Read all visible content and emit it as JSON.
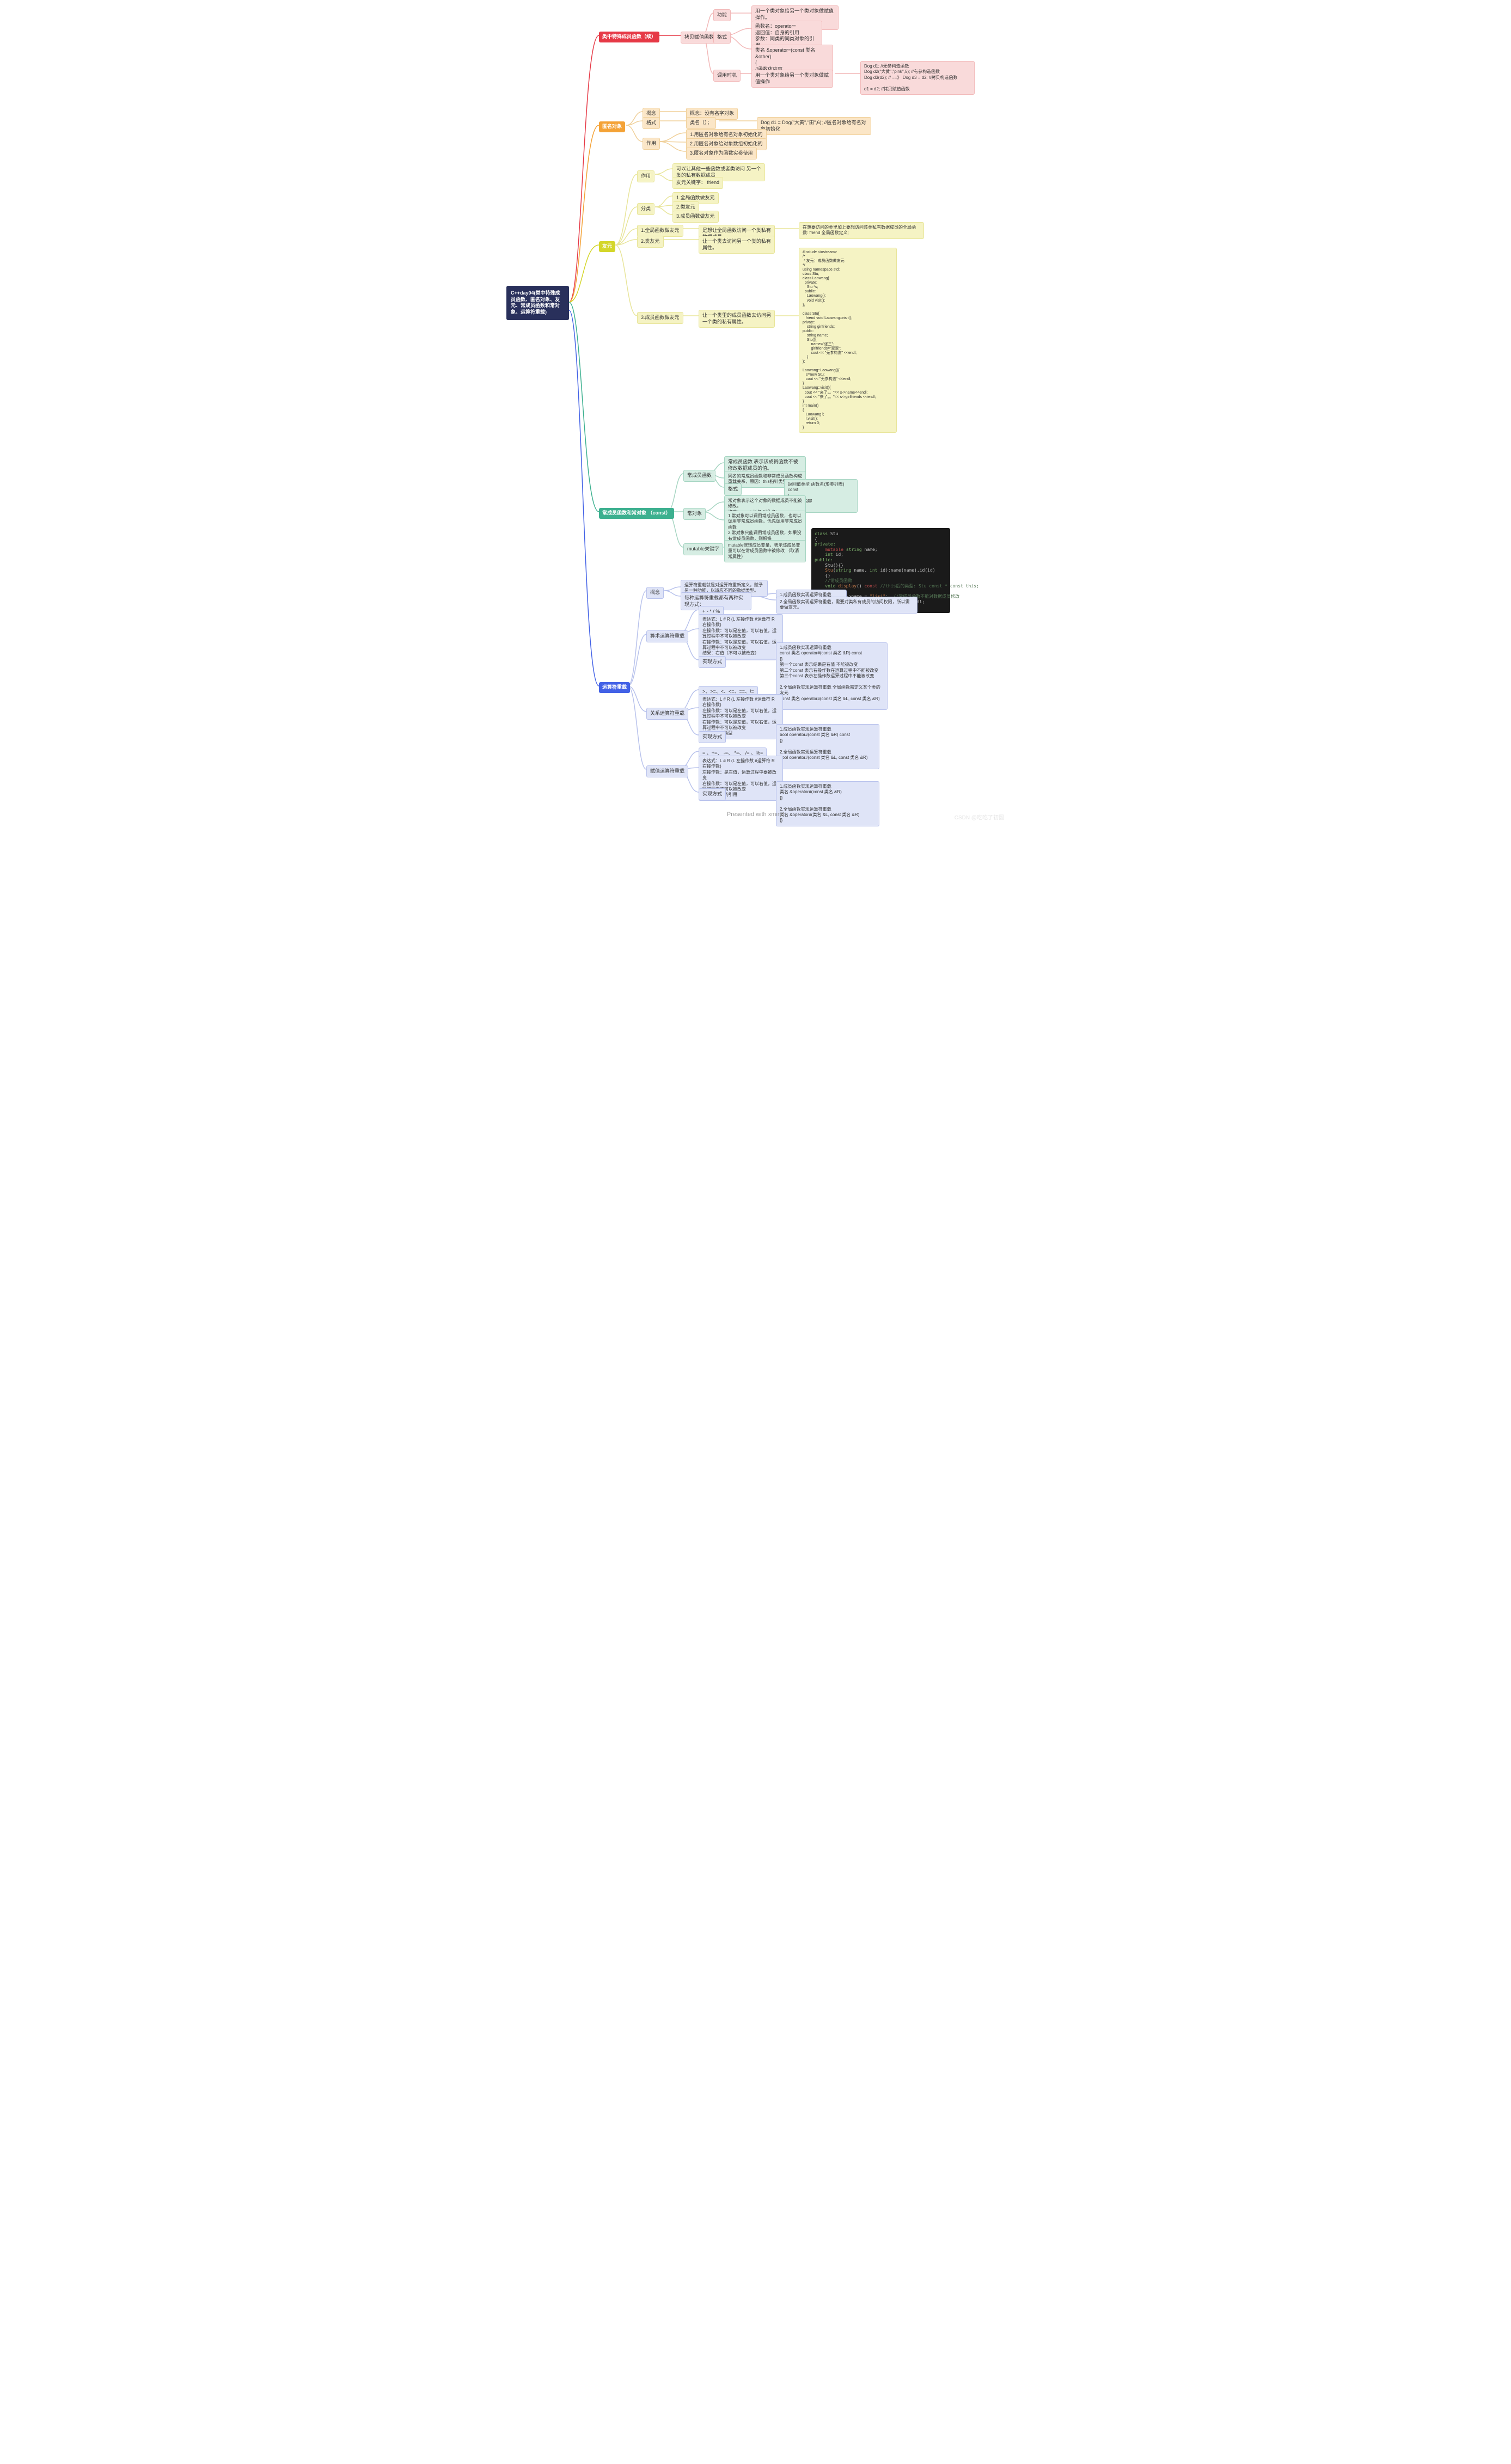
{
  "root": "C++day04(类中特殊成员函数、匿名对象、友元、常成员函数和常对象、运算符重载)",
  "s1": {
    "title": "类中特殊成员函数（续）",
    "sub": "拷贝赋值函数",
    "a": {
      "l": "功能",
      "t": "用一个类对象给另一个类对象做赋值操作。\n本质上是赋值运算符重载。"
    },
    "b": {
      "l": "格式",
      "t1": "函数名：operator=\n返回值：自身的引用\n参数：同类的同类对象的引用\n权限：一般为public",
      "t2": "类名 &operator=(const 类名&other)\n{\n    //函数体内容\n}"
    },
    "c": {
      "l": "调用时机",
      "t": "用一个类对象给另一个类对象做赋值操作",
      "ex": "Dog d1; //无参构造函数\n  Dog d2(\"大黄\",\"pink\",5); //有参构造函数\n  Dog d3(d2);  // ==》 Dog d3 = d2; //拷贝构造函数\n\nd1 = d2; //拷贝赋值函数"
    }
  },
  "s2": {
    "title": "匿名对象",
    "a": {
      "l": "概念",
      "t": "概念：没有名字对象"
    },
    "b": {
      "l": "格式",
      "t": "类名（）；",
      "ex": "Dog d1 = Dog(\"大黄\",\"田\",6); //匿名对象给有名对象初始化"
    },
    "c": {
      "l": "作用",
      "i1": "1.用匿名对象给有名对象初始化的",
      "i2": "2.用匿名对象给对象数组初始化的",
      "i3": "3.匿名对象作为函数实参使用"
    }
  },
  "s3": {
    "title": "友元",
    "a": {
      "l": "作用",
      "t1": "可以让其他一些函数或者类访问 另一个类的私有数据成员",
      "t2": "友元关键字： friend"
    },
    "b": {
      "l": "分类",
      "i1": "1.全局函数做友元",
      "i2": "2.类友元",
      "i3": "3.成员函数做友元"
    },
    "c": {
      "l": "1.全局函数做友元",
      "t": "是想让全局函数访问一个类私有数据成员。",
      "ex": "在想要访问的类里加上要想访问该类私有数据成员的全局函数:  friend 全局函数定义;"
    },
    "d": {
      "l": "2.类友元",
      "t": "让一个类去访问另一个类的私有属性。"
    },
    "e": {
      "l": "3.成员函数做友元",
      "t": "让一个类里的成员函数去访问另一个类的私有属性。",
      "code": "#include <iostream>\n/*\n * 友元：成员函数做友元\n*/\nusing namespace std;\nclass Stu;\nclass Laowang{\n  private:\n    Stu *s;\n  public:\n    Laowang();\n    void visit();\n};\n\nclass Stu{\n   friend void Laowang::visit();\nprivate:\n    string girlfriends;\npublic:\n    string name;\n    Stu(){\n        name=\"张三\";\n        girlfriends=\"翠翠\";\n        cout << \"无参构造\" <<endl;\n    }\n};\n\nLaowang::Laowang(){\n   s=new Stu;\n   cout << \"无参构造\" <<endl;\n}\nLaowang::visit(){\n  cout << \"来了。。\"<< s->name<<endl;\n  cout << \"来了。。\"<< s->girlfriends <<endl;\n}\nint main()\n{\n   Laowang l;\n   l.visit();\n   return 0;\n}"
    }
  },
  "s4": {
    "title": "常成员函数和常对象 （const）",
    "a": {
      "l": "常成员函数",
      "t": "常成员函数 表示该成员函数不被修改数据成员的值。",
      "n": "同名的常成员函数和非常成员函数构成重载关系，原因：this指针类型不同",
      "f": {
        "l": "格式",
        "t": "返回值类型 函数名(形参列表) const\n{\n   //函数体内容\n}"
      }
    },
    "b": {
      "l": "常对象",
      "t": "常对象表示这个对象的数据成员不能被修改。\n格式：const 类名 对象名；",
      "n": "1.常对象可以调用常成员函数，也可以调用非常成员函数，优先调用非常成员函数\n2.常对象只能调用常成员函数，如果没有常成员函数，则报错"
    },
    "c": {
      "l": "mutable关键字",
      "t": "mutable修饰成员变量，表示该成员变量可以在常成员函数中被修改 （取消常属性）"
    }
  },
  "s5": {
    "title": "运算符重载",
    "a": {
      "l": "概念",
      "t": "运算符重载就是对运算符重新定义，赋予另一种功能，以适应不同的数据类型。",
      "m": {
        "l": "每种运算符重载都有两种实现方式：",
        "i1": "1.成员函数实现运算符重载",
        "i2": "2.全局函数实现运算符重载，需要对类私有成员的访问权限，所以需要做友元。"
      }
    },
    "b": {
      "l": "算术运算符重载",
      "ops": "+  -  *  /  %",
      "desc": "表达式：L  #  R  (L 左操作数    #运算符  R 右操作数)\n左操作数：可以是左值，可以右值，运算过程中不可以被改变\n右操作数：可以是左值，可以右值，运算过程中不可以被改变\n结果：右值（不可以被改变）",
      "impl": {
        "l": "实现方式",
        "t": "1.成员函数实现运算符重载\n   const 类名 operator#(const 类名 &R) const\n   {}\n  第一个const 表示结果是右值 不能被改变\n  第二个const 表示右操作数在运算过程中不能被改变\n  第三个const 表示左操作数运算过程中不能被改变\n\n2.全局函数实现运算符重载 全局函数需定义某个类的友元\n  const 类名 operator#(const 类名 &L, const 类名 &R)\n  {}"
      }
    },
    "c": {
      "l": "关系运算符重载",
      "ops": ">、>=、<、<=、==、!=",
      "desc": "表达式：L  #  R  (L 左操作数    #运算符  R 右操作数)\n左操作数：可以是左值，可以右值，运算过程中不可以被改变\n右操作数：可以是左值，可以右值，运算过程中不可以被改变\n结果：bool类型",
      "impl": {
        "l": "实现方式",
        "t": "1.成员函数实现运算符重载\n  bool operator#(const 类名 &R) const\n  {}\n\n2.全局函数实现运算符重载\n  bool operator#(const 类名 &L, const 类名 &R)\n  {}"
      }
    },
    "d": {
      "l": "赋值运算符重载",
      "ops": "= 、+=、 -=、 *=、 /= 、%=",
      "desc": "表达式：L  #  R  (L 左操作数    #运算符  R 右操作数)\n左操作数：是左值，运算过程中要被改变\n右操作数：可以是左值，可以右值，运算过程中不可以被改变\n结果：自身的引用",
      "impl": {
        "l": "实现方式",
        "t": "1.成员函数实现运算符重载\n  类名 &operator#(const 类名 &R)\n  {}\n\n2.全局函数实现运算符重载\n  类名 &operator#(类名 &L,  const 类名 &R)\n  {}"
      }
    }
  },
  "code4": "class Stu\n{\nprivate:\n    mutable string name;\n    int id;\npublic:\n    Stu(){}\n    Stu(string name, int id):name(name),id(id)\n    {}\n    //常成员函数\n    void display() const //this后的类型：Stu const * const this;\n    {\n        this->name = \"lisi\";  //常成员函数不能对数据成员修改\n        cout << name << \" \" << id << endl;\n    }",
  "footer": "Presented with xmind",
  "wm": "CSDN @吃吃了初圆"
}
